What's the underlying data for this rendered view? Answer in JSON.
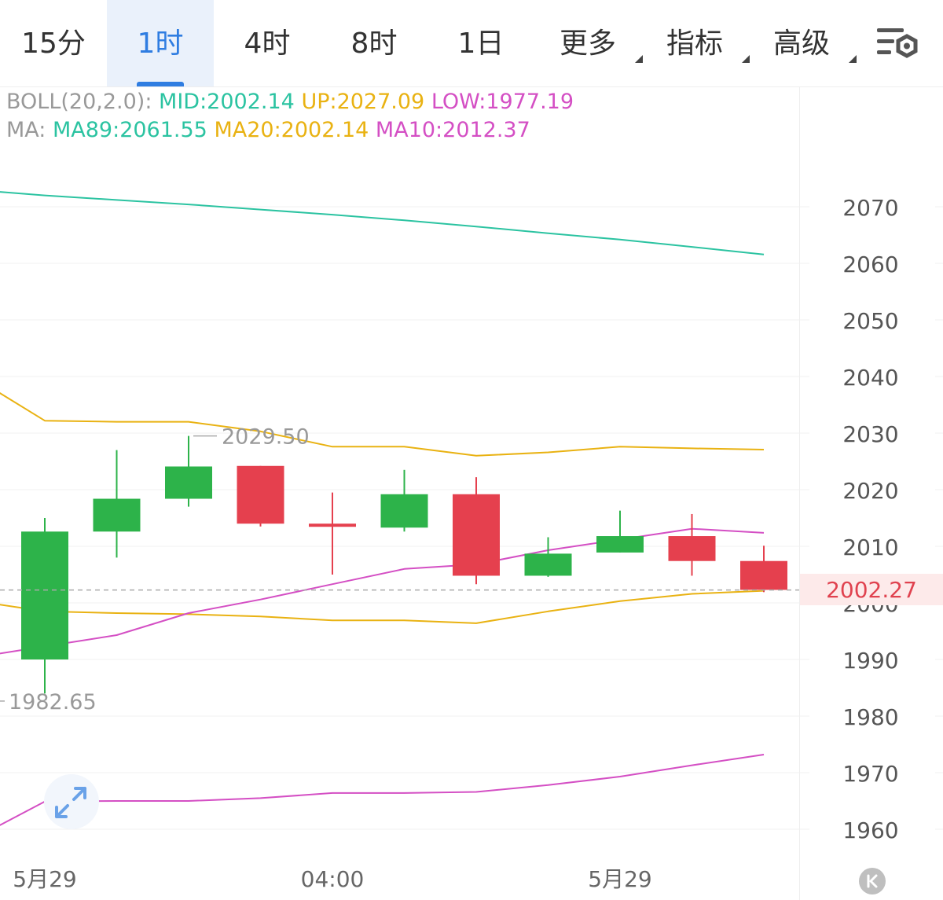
{
  "toolbar": {
    "tabs": [
      {
        "label": "15分",
        "active": false,
        "dropdown": false
      },
      {
        "label": "1时",
        "active": true,
        "dropdown": false
      },
      {
        "label": "4时",
        "active": false,
        "dropdown": false
      },
      {
        "label": "8时",
        "active": false,
        "dropdown": false
      },
      {
        "label": "1日",
        "active": false,
        "dropdown": false
      },
      {
        "label": "更多",
        "active": false,
        "dropdown": true
      },
      {
        "label": "指标",
        "active": false,
        "dropdown": true
      },
      {
        "label": "高级",
        "active": false,
        "dropdown": true
      }
    ],
    "settings_icon": "chart-settings-icon"
  },
  "legend": {
    "boll": {
      "prefix": "BOLL(20,2.0):",
      "mid": "MID:2002.14",
      "up": "UP:2027.09",
      "low": "LOW:1977.19"
    },
    "ma": {
      "prefix": "MA:",
      "ma89": "MA89:2061.55",
      "ma20": "MA20:2002.14",
      "ma10": "MA10:2012.37"
    }
  },
  "colors": {
    "up_candle": "#2db34a",
    "down_candle": "#e5404e",
    "teal": "#2bc3a1",
    "gold": "#e9b212",
    "pink": "#d44fc4",
    "accent": "#2f7de1"
  },
  "last_price": "2002.27",
  "chart_data": {
    "type": "candlestick",
    "ylim": [
      1952,
      2077
    ],
    "y_ticks": [
      1960,
      1970,
      1980,
      1990,
      2000,
      2010,
      2020,
      2030,
      2040,
      2050,
      2060,
      2070
    ],
    "x_labels": [
      "5月29",
      "04:00",
      "5月29"
    ],
    "high_label": "2029.50",
    "low_label": "1982.65",
    "candles": [
      {
        "open": 1990,
        "high": 2015,
        "low": 1984,
        "close": 2012.6
      },
      {
        "open": 2012.6,
        "high": 2027,
        "low": 2008,
        "close": 2018.4
      },
      {
        "open": 2018.4,
        "high": 2029.5,
        "low": 2017,
        "close": 2024.1
      },
      {
        "open": 2024.2,
        "high": 2024.2,
        "low": 2013.5,
        "close": 2014
      },
      {
        "open": 2014,
        "high": 2019.5,
        "low": 2005,
        "close": 2013.6
      },
      {
        "open": 2013.3,
        "high": 2023.5,
        "low": 2012.6,
        "close": 2019.2
      },
      {
        "open": 2019.2,
        "high": 2022.2,
        "low": 2003.3,
        "close": 2004.8
      },
      {
        "open": 2004.8,
        "high": 2011.6,
        "low": 2004.6,
        "close": 2008.7
      },
      {
        "open": 2008.9,
        "high": 2016.3,
        "low": 2008.9,
        "close": 2011.8
      },
      {
        "open": 2011.8,
        "high": 2015.7,
        "low": 2004.8,
        "close": 2007.4
      },
      {
        "open": 2007.4,
        "high": 2010.1,
        "low": 2001.9,
        "close": 2002.3
      }
    ],
    "series": [
      {
        "name": "MA89",
        "color": "#2bc3a1",
        "x": [
          -1,
          0,
          1,
          2,
          3,
          4,
          5,
          6,
          7,
          8,
          9,
          10
        ],
        "values": [
          2073,
          2072,
          2071.2,
          2070.4,
          2069.5,
          2068.6,
          2067.6,
          2066.5,
          2065.3,
          2064.2,
          2062.9,
          2061.55
        ]
      },
      {
        "name": "MA20",
        "color": "#e9b212",
        "x": [
          -1,
          0,
          1,
          2,
          3,
          4,
          5,
          6,
          7,
          8,
          9,
          10
        ],
        "values": [
          2040,
          2032.2,
          2032,
          2032,
          2030.3,
          2027.6,
          2027.6,
          2026,
          2026.6,
          2027.6,
          2027.3,
          2027.09
        ]
      },
      {
        "series_role": "mid",
        "color": "#e9b212",
        "x": [
          -1,
          0,
          1,
          2,
          3,
          4,
          5,
          6,
          7,
          8,
          9,
          10
        ],
        "values": [
          2000.4,
          1998.5,
          1998.2,
          1998,
          1997.6,
          1996.9,
          1996.9,
          1996.4,
          1998.5,
          2000.3,
          2001.6,
          2002.14
        ]
      },
      {
        "name": "MA10",
        "color": "#d44fc4",
        "x": [
          -1,
          0,
          1,
          2,
          3,
          4,
          5,
          6,
          7,
          8,
          9,
          10
        ],
        "values": [
          1990.3,
          1992.3,
          1994.3,
          1998.2,
          2000.6,
          2003.3,
          2006,
          2006.8,
          2009.3,
          2011.2,
          2013.1,
          2012.37
        ]
      },
      {
        "series_role": "lower",
        "color": "#d44fc4",
        "x": [
          -1,
          0,
          1,
          2,
          3,
          4,
          5,
          6,
          7,
          8,
          9,
          10
        ],
        "values": [
          1958.2,
          1964.9,
          1965,
          1965,
          1965.5,
          1966.4,
          1966.4,
          1966.6,
          1967.8,
          1969.3,
          1971.3,
          1973.2
        ]
      }
    ]
  }
}
